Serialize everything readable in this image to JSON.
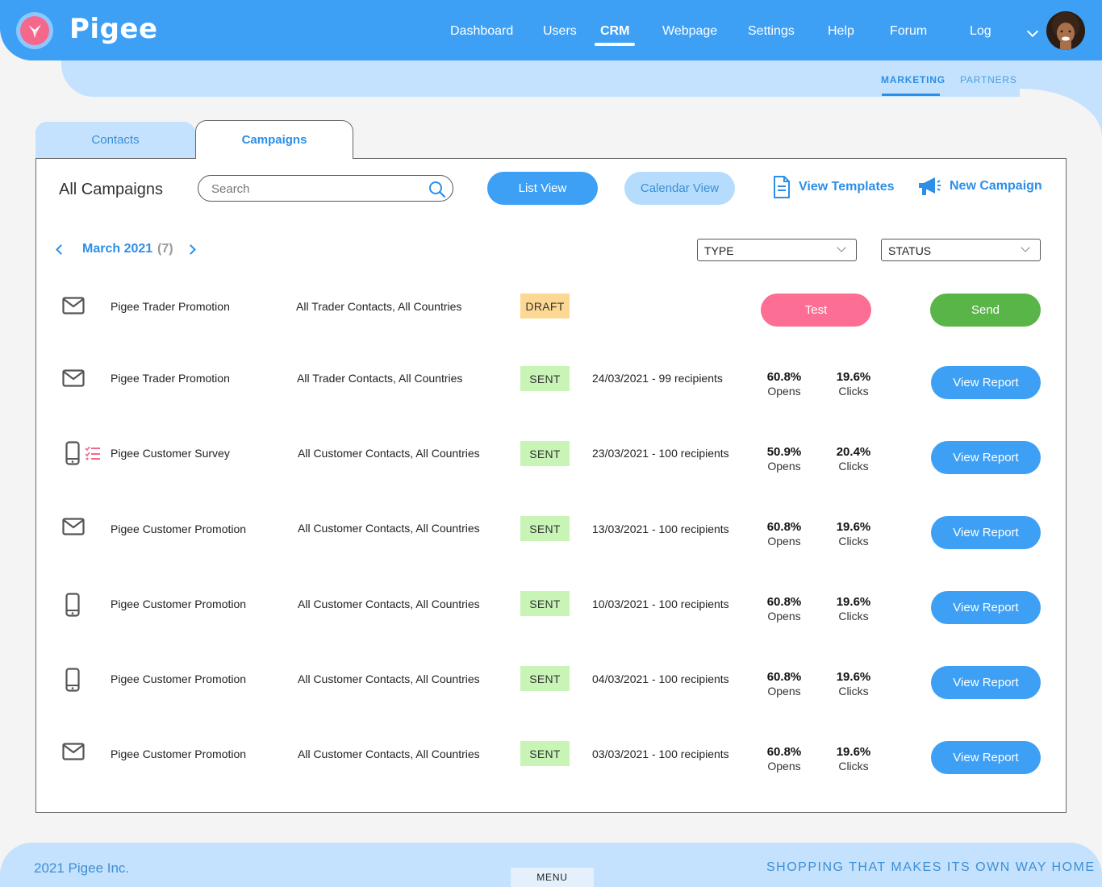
{
  "app": {
    "brand": "Pigee"
  },
  "nav": {
    "items": [
      "Dashboard",
      "Users",
      "CRM",
      "Webpage",
      "Settings",
      "Help",
      "Forum",
      "Log"
    ],
    "active": "CRM"
  },
  "subnav": {
    "marketing": "MARKETING",
    "partners": "PARTNERS"
  },
  "tabs": {
    "contacts": "Contacts",
    "campaigns": "Campaigns"
  },
  "toolbar": {
    "title": "All Campaigns",
    "search_placeholder": "Search",
    "list_view": "List View",
    "calendar_view": "Calendar View",
    "view_templates": "View Templates",
    "new_campaign": "New Campaign"
  },
  "period": {
    "label": "March 2021",
    "count": "(7)"
  },
  "filters": {
    "type": "TYPE",
    "status": "STATUS"
  },
  "draft_row": {
    "icon": "envelope-icon",
    "name": "Pigee Trader Promotion",
    "audience": "All Trader Contacts, All Countries",
    "status": "DRAFT",
    "test_label": "Test",
    "send_label": "Send"
  },
  "campaigns": [
    {
      "icon": "envelope-icon",
      "name": "Pigee Trader Promotion",
      "audience": "All Trader Contacts, All Countries",
      "status": "SENT",
      "date": "24/03/2021 - 99 recipients",
      "opens": "60.8%",
      "opens_label": "Opens",
      "clicks": "19.6%",
      "clicks_label": "Clicks",
      "action": "View Report"
    },
    {
      "icon": "phone-survey-icon",
      "name": "Pigee Customer Survey",
      "audience": "All Customer Contacts, All Countries",
      "status": "SENT",
      "date": "23/03/2021 - 100 recipients",
      "opens": "50.9%",
      "opens_label": "Opens",
      "clicks": "20.4%",
      "clicks_label": "Clicks",
      "action": "View Report"
    },
    {
      "icon": "envelope-icon",
      "name": "Pigee Customer Promotion",
      "audience": "All Customer Contacts, All Countries",
      "status": "SENT",
      "date": "13/03/2021 - 100 recipients",
      "opens": "60.8%",
      "opens_label": "Opens",
      "clicks": "19.6%",
      "clicks_label": "Clicks",
      "action": "View Report"
    },
    {
      "icon": "phone-icon",
      "name": "Pigee Customer Promotion",
      "audience": "All Customer Contacts, All Countries",
      "status": "SENT",
      "date": "10/03/2021 - 100 recipients",
      "opens": "60.8%",
      "opens_label": "Opens",
      "clicks": "19.6%",
      "clicks_label": "Clicks",
      "action": "View Report"
    },
    {
      "icon": "phone-icon",
      "name": "Pigee Customer Promotion",
      "audience": "All Customer Contacts, All Countries",
      "status": "SENT",
      "date": "04/03/2021 - 100 recipients",
      "opens": "60.8%",
      "opens_label": "Opens",
      "clicks": "19.6%",
      "clicks_label": "Clicks",
      "action": "View Report"
    },
    {
      "icon": "envelope-icon",
      "name": "Pigee Customer Promotion",
      "audience": "All Customer Contacts, All Countries",
      "status": "SENT",
      "date": "03/03/2021 - 100 recipients",
      "opens": "60.8%",
      "opens_label": "Opens",
      "clicks": "19.6%",
      "clicks_label": "Clicks",
      "action": "View Report"
    }
  ],
  "footer": {
    "copyright": "2021 Pigee Inc.",
    "tagline": "SHOPPING THAT MAKES ITS OWN WAY HOME",
    "menu": "MENU"
  },
  "colors": {
    "primary": "#3da0f5",
    "light": "#c4e2fd",
    "draft": "#fcd893",
    "sent": "#c8f5b5",
    "test": "#fd6e94",
    "send": "#5ab548"
  }
}
